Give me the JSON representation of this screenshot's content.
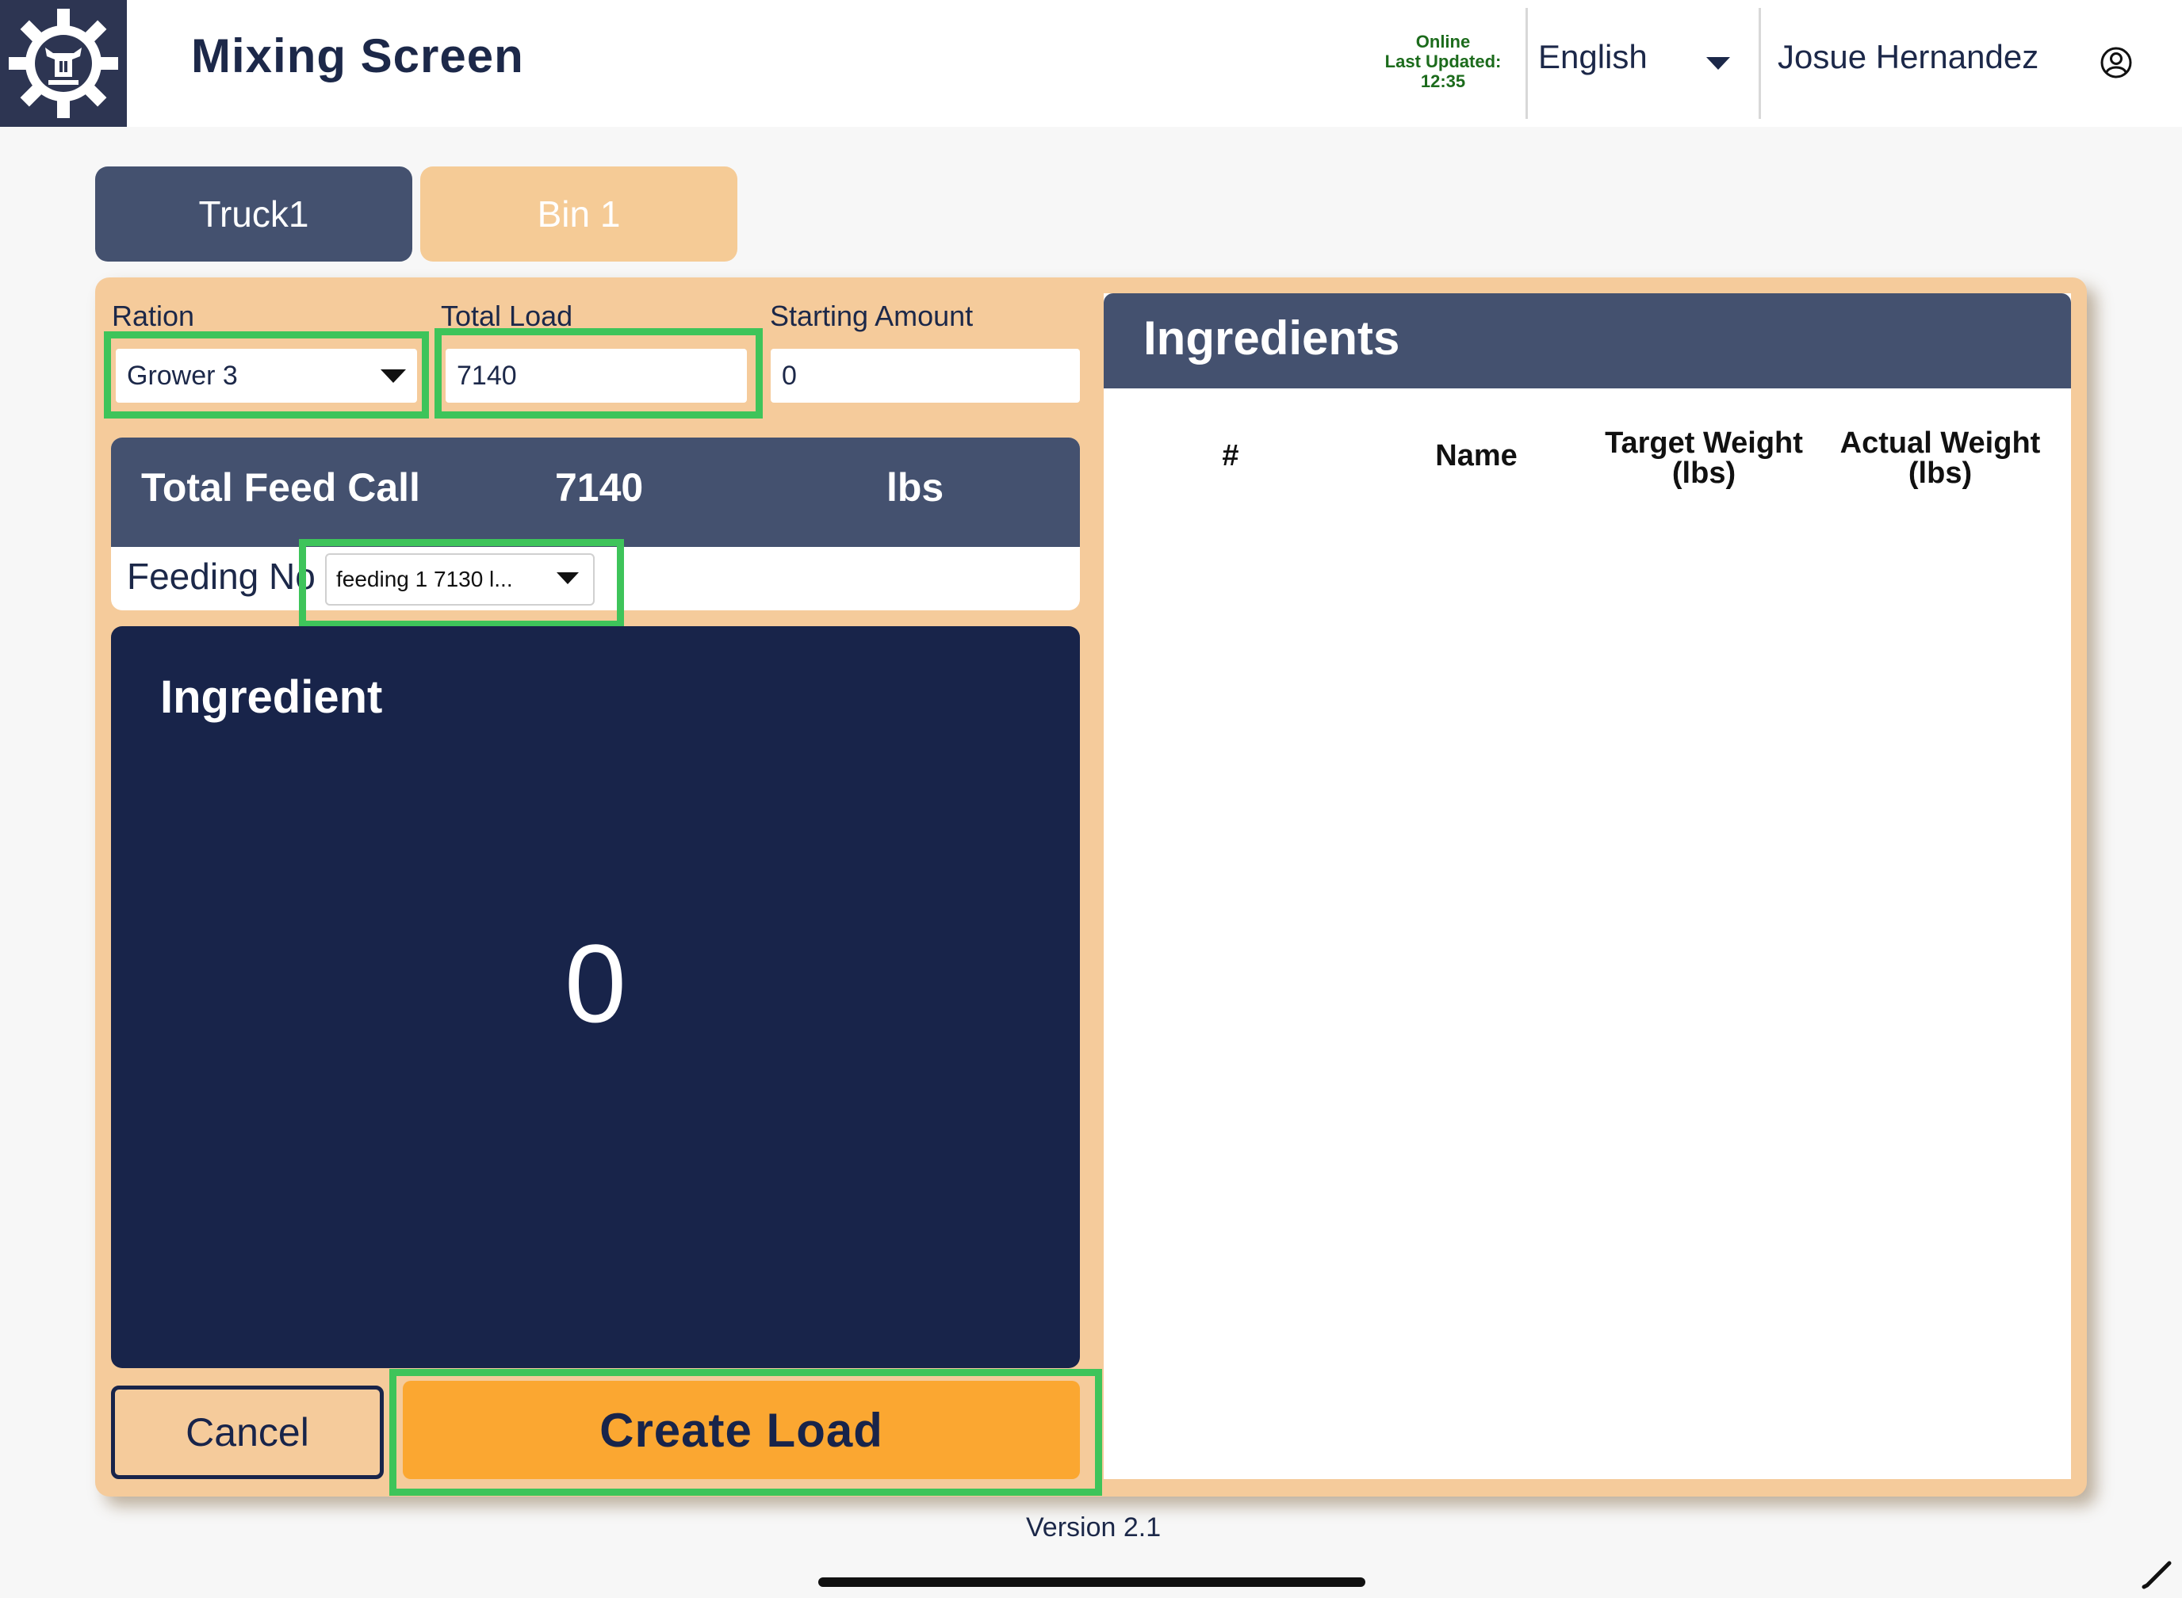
{
  "header": {
    "title": "Mixing Screen",
    "status": {
      "online": "Online",
      "last_updated_label": "Last Updated:",
      "last_updated_time": "12:35"
    },
    "language": "English",
    "user_name": "Josue Hernandez"
  },
  "tabs": [
    {
      "label": "Truck1",
      "active": true
    },
    {
      "label": "Bin 1",
      "active": false
    }
  ],
  "form": {
    "ration_label": "Ration",
    "ration_value": "Grower 3",
    "total_load_label": "Total Load",
    "total_load_value": "7140",
    "starting_amount_label": "Starting Amount",
    "starting_amount_value": "0"
  },
  "feed_call": {
    "label": "Total Feed Call",
    "value": "7140",
    "unit": "lbs",
    "feeding_label": "Feeding No.",
    "feeding_select_value": "feeding 1   7130 l..."
  },
  "ingredient": {
    "title": "Ingredient",
    "value": "0"
  },
  "actions": {
    "cancel_label": "Cancel",
    "create_label": "Create Load"
  },
  "ingredients_table": {
    "title": "Ingredients",
    "columns": [
      "#",
      "Name",
      "Target Weight (lbs)",
      "Actual Weight (lbs)"
    ]
  },
  "footer": {
    "version": "Version 2.1"
  },
  "colors": {
    "navy": "#18244a",
    "slate": "#44516f",
    "peach": "#f5cb9b",
    "orange": "#fba731",
    "highlight": "#3ec45a",
    "status_green": "#1c6b1c"
  },
  "icons": {
    "logo": "gear-bull-logo-icon",
    "language_dropdown": "caret-down-icon",
    "user": "user-circle-icon"
  }
}
